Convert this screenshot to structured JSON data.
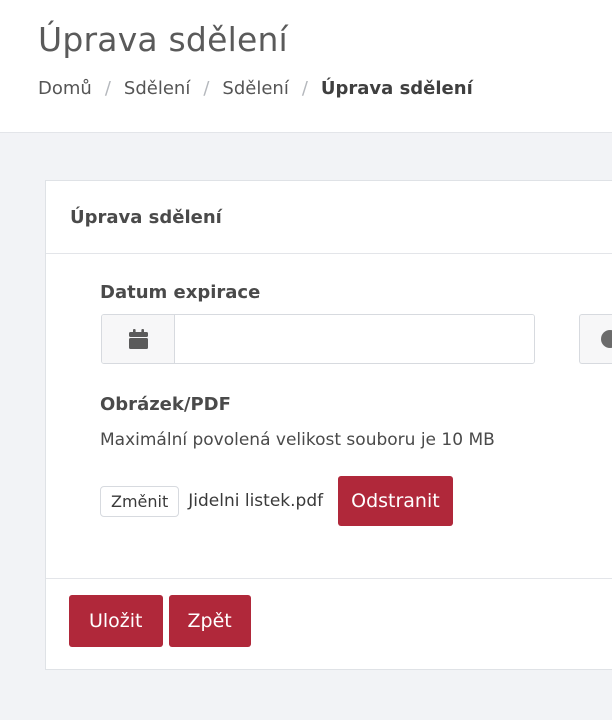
{
  "header": {
    "title": "Úprava sdělení",
    "breadcrumb": [
      "Domů",
      "Sdělení",
      "Sdělení",
      "Úprava sdělení"
    ],
    "separator": "/"
  },
  "card": {
    "title": "Úprava sdělení",
    "expiry": {
      "label": "Datum expirace",
      "date_value": "",
      "calendar_icon": "calendar-icon",
      "time_icon": "clock-icon"
    },
    "attachment": {
      "label": "Obrázek/PDF",
      "help": "Maximální povolená velikost souboru je 10 MB",
      "change_label": "Změnit",
      "file_name": "Jidelni listek.pdf",
      "remove_label": "Odstranit"
    },
    "actions": {
      "save_label": "Uložit",
      "back_label": "Zpět"
    }
  },
  "colors": {
    "danger": "#b0283a",
    "background": "#f2f3f6"
  }
}
